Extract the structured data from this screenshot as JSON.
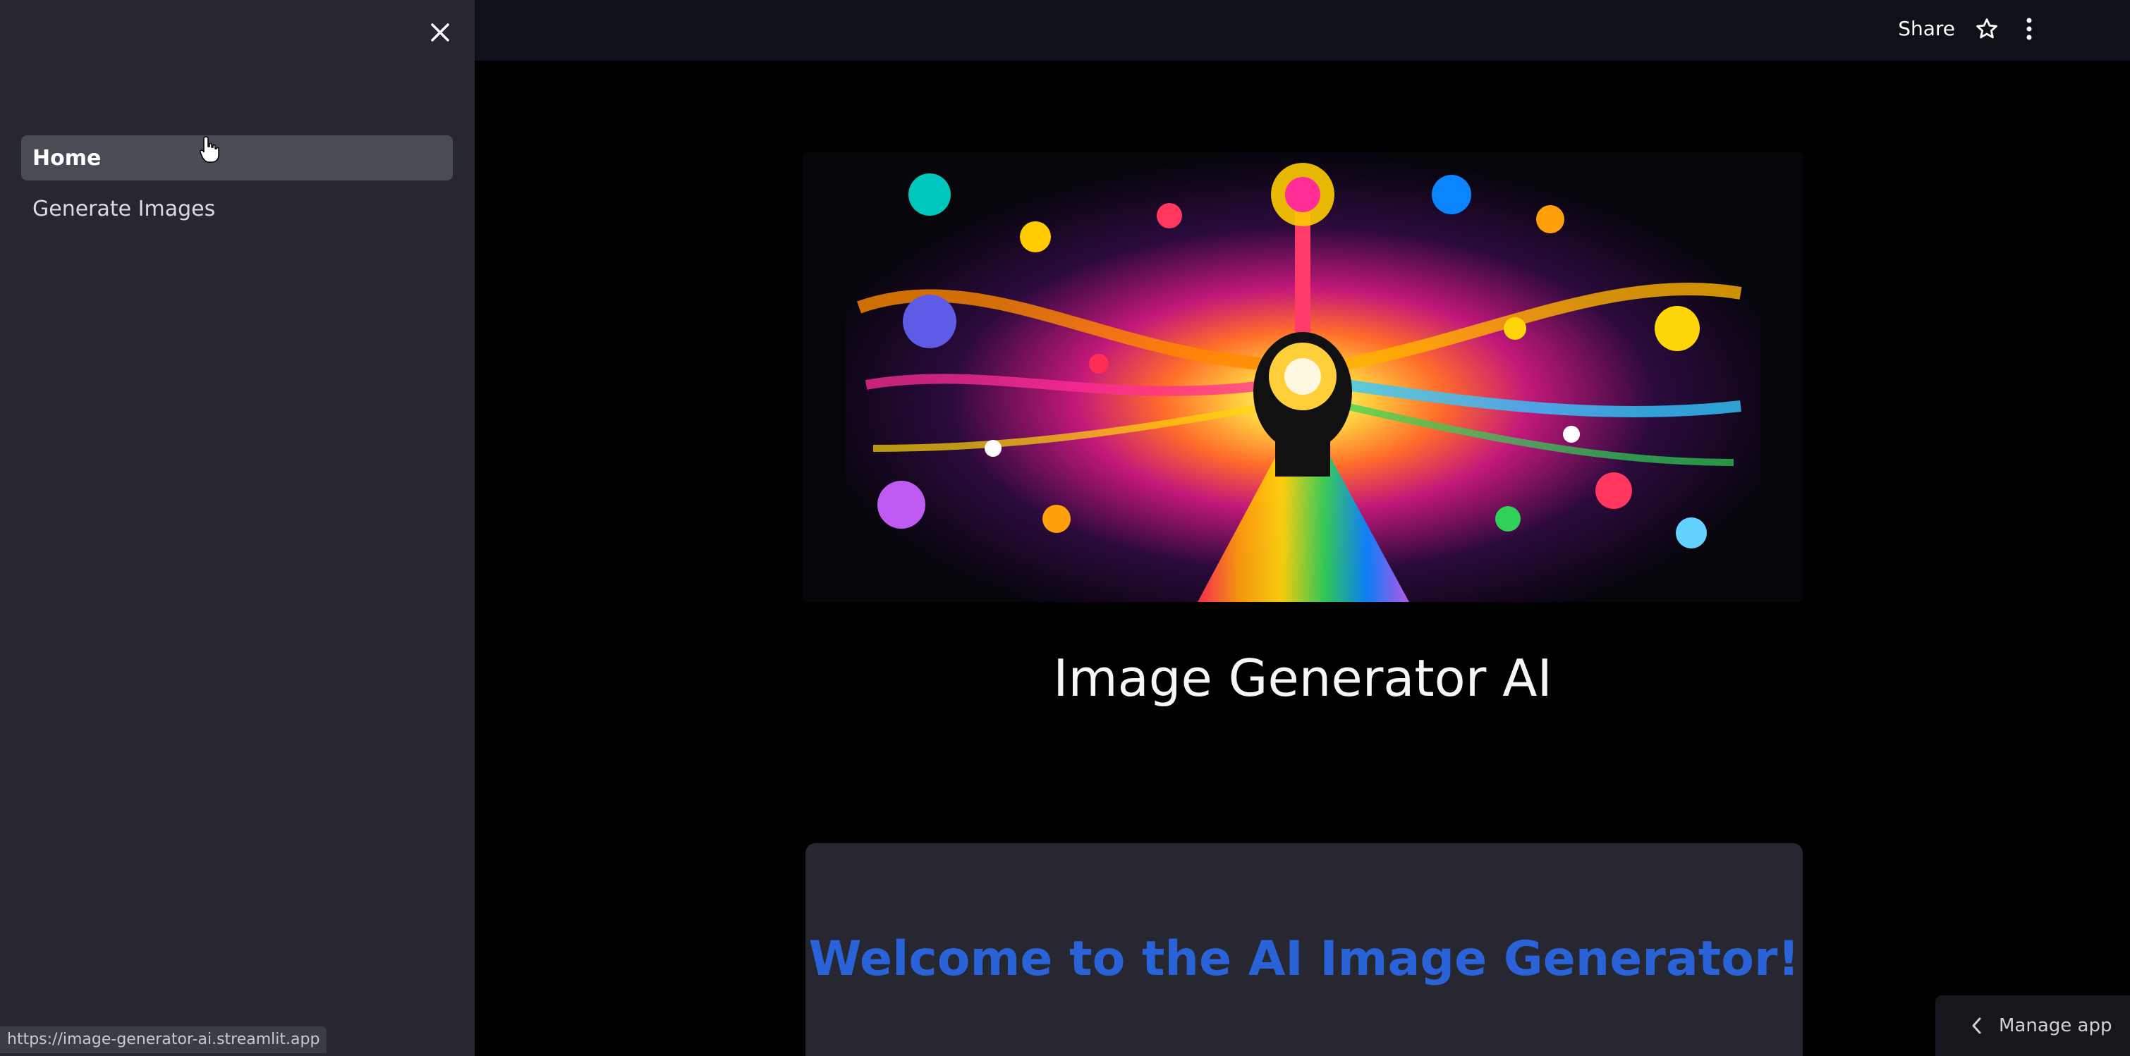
{
  "sidebar": {
    "items": [
      {
        "label": "Home",
        "active": true
      },
      {
        "label": "Generate Images",
        "active": false
      }
    ],
    "status_url": "https://image-generator-ai.streamlit.app"
  },
  "header": {
    "share_label": "Share"
  },
  "main": {
    "title": "Image Generator AI",
    "welcome_text": "Welcome to the AI Image Generator!"
  },
  "manage_app_label": "Manage app",
  "icons": {
    "close": "close-icon",
    "star": "star-icon",
    "more": "more-vertical-icon",
    "chevron": "chevron-left-icon"
  },
  "colors": {
    "sidebar_bg": "#262730",
    "header_bg": "#0e1117",
    "main_bg": "#000000",
    "welcome_blue": "#2a63d8"
  }
}
